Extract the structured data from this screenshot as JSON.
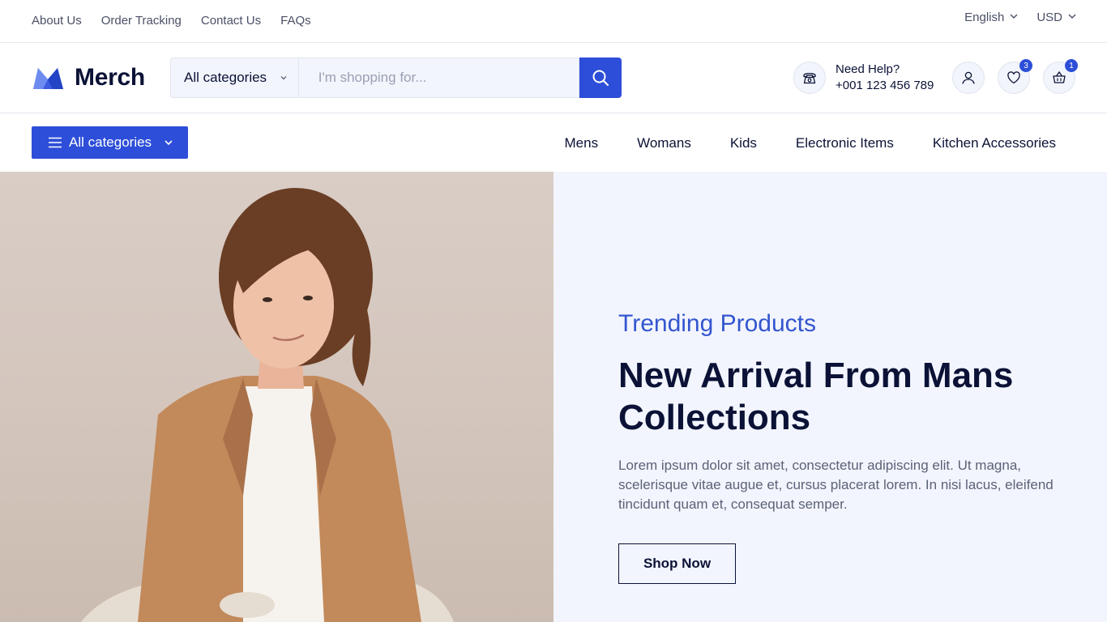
{
  "topbar": {
    "links": [
      "About Us",
      "Order Tracking",
      "Contact Us",
      "FAQs"
    ],
    "language": "English",
    "currency": "USD"
  },
  "header": {
    "brand": "Merch",
    "search": {
      "category": "All categories",
      "placeholder": "I'm shopping for..."
    },
    "help": {
      "label": "Need Help?",
      "phone": "+001 123 456 789"
    },
    "wishlist_count": "3",
    "cart_count": "1"
  },
  "nav": {
    "all_categories": "All categories",
    "links": [
      "Mens",
      "Womans",
      "Kids",
      "Electronic Items",
      "Kitchen Accessories"
    ]
  },
  "hero": {
    "kicker": "Trending Products",
    "headline": "New Arrival From Mans Collections",
    "description": "Lorem ipsum dolor sit amet, consectetur adipiscing elit. Ut magna, scelerisque vitae augue et, cursus placerat lorem. In nisi lacus, eleifend tincidunt quam et, consequat semper.",
    "cta": "Shop Now"
  },
  "colors": {
    "accent": "#2d4ed8",
    "kicker": "#3356cf",
    "text_dark": "#0b1236",
    "panel_bg": "#f2f5fd"
  }
}
